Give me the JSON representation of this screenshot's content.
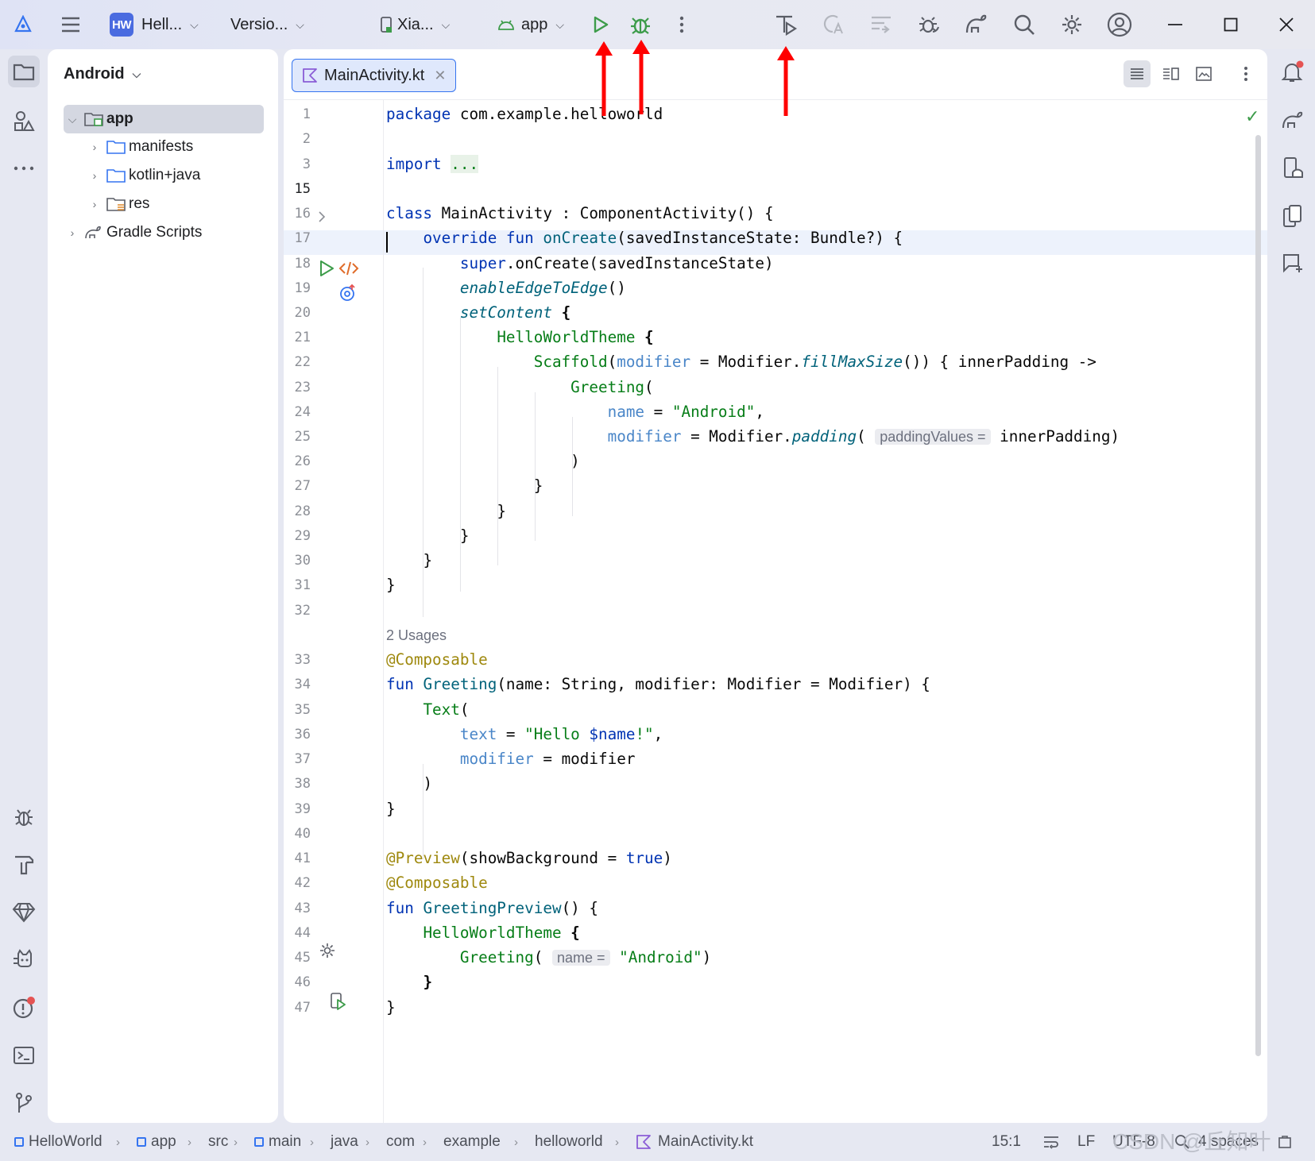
{
  "titlebar": {
    "project_badge": "HW",
    "project_name": "Hell...",
    "vcs": "Versio...",
    "device": "Xia...",
    "run_config": "app",
    "icons": [
      "android-studio-logo",
      "main-menu-icon",
      "run-icon",
      "debug-icon",
      "more-icon",
      "apply-changes-icon",
      "apply-code-changes-icon",
      "sync-icon",
      "profile-icon",
      "gradle-sync-icon",
      "search-icon",
      "settings-icon",
      "account-icon",
      "minimize-icon",
      "maximize-icon",
      "close-icon"
    ]
  },
  "project_panel": {
    "view": "Android",
    "tree": [
      {
        "label": "app",
        "level": 0,
        "expanded": true
      },
      {
        "label": "manifests",
        "level": 1
      },
      {
        "label": "kotlin+java",
        "level": 1
      },
      {
        "label": "res",
        "level": 1
      },
      {
        "label": "Gradle Scripts",
        "level": 0
      }
    ]
  },
  "editor": {
    "tab_label": "MainActivity.kt",
    "usages_text": "2 Usages",
    "line_numbers": [
      "1",
      "2",
      "3",
      "15",
      "16",
      "17",
      "18",
      "19",
      "20",
      "21",
      "22",
      "23",
      "24",
      "25",
      "26",
      "27",
      "28",
      "29",
      "30",
      "31",
      "32",
      "33",
      "34",
      "35",
      "36",
      "37",
      "38",
      "39",
      "40",
      "41",
      "42",
      "43",
      "44",
      "45",
      "46",
      "47"
    ],
    "code": {
      "l1a": "package",
      "l1b": " com.example.helloworld",
      "l3a": "import",
      "l3b": "...",
      "l16a": "class",
      "l16b": " MainActivity : ComponentActivity() {",
      "l17a": "override",
      "l17b": "fun",
      "l17c": "onCreate",
      "l17d": "(savedInstanceState: Bundle?) {",
      "l18a": "super",
      "l18b": ".onCreate(savedInstanceState)",
      "l19a": "enableEdgeToEdge",
      "l19b": "()",
      "l20a": "setContent",
      "l20b": "{",
      "l21a": "HelloWorldTheme",
      "l21b": "{",
      "l22a": "Scaffold",
      "l22b": "(",
      "l22c": "modifier",
      "l22d": " = Modifier.",
      "l22e": "fillMaxSize",
      "l22f": "()) { innerPadding ->",
      "l23a": "Greeting",
      "l23b": "(",
      "l24a": "name",
      "l24b": " = ",
      "l24c": "\"Android\"",
      "l24d": ",",
      "l25a": "modifier",
      "l25b": " = Modifier.",
      "l25c": "padding",
      "l25d": "(",
      "l25e": "paddingValues =",
      "l25f": "innerPadding)",
      "l26": ")",
      "l27": "}",
      "l28": "}",
      "l29": "}",
      "l30": "}",
      "l31": "}",
      "l33": "@Composable",
      "l34a": "fun",
      "l34b": "Greeting",
      "l34c": "(name: String, modifier: Modifier = Modifier) {",
      "l35a": "Text",
      "l35b": "(",
      "l36a": "text",
      "l36b": " = ",
      "l36c": "\"Hello ",
      "l36d": "$name",
      "l36e": "!\"",
      "l36f": ",",
      "l37a": "modifier",
      "l37b": " = modifier",
      "l38": ")",
      "l39": "}",
      "l41a": "@Preview",
      "l41b": "(showBackground = ",
      "l41c": "true",
      "l41d": ")",
      "l42": "@Composable",
      "l43a": "fun",
      "l43b": "GreetingPreview",
      "l43c": "() {",
      "l44a": "HelloWorldTheme",
      "l44b": "{",
      "l45a": "Greeting",
      "l45b": "(",
      "l45c": "name =",
      "l45d": "\"Android\"",
      "l45e": ")",
      "l46": "}",
      "l47": "}"
    }
  },
  "statusbar": {
    "breadcrumbs": [
      "HelloWorld",
      "app",
      "src",
      "main",
      "java",
      "com",
      "example",
      "helloworld",
      "MainActivity.kt"
    ],
    "position": "15:1",
    "line_ending": "LF",
    "encoding": "UTF-8",
    "indent": "4 spaces"
  },
  "watermark": "CSDN @丘知叶",
  "colors": {
    "accent": "#3574f0",
    "run_green": "#3d9c4a",
    "annotation_red": "#ff0000"
  }
}
